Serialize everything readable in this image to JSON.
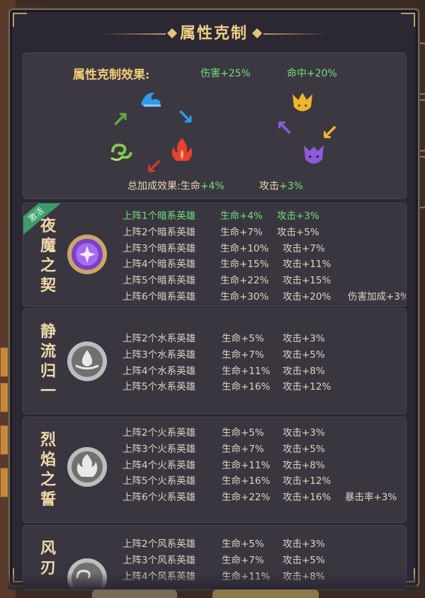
{
  "panel": {
    "title": "属性克制"
  },
  "effect": {
    "label": "属性克制效果:",
    "damage": "伤害+25%",
    "hit": "命中+20%",
    "total_label": "总加成效果:生命",
    "total_hp": "+4%",
    "total_atk_label": "攻击",
    "total_atk": "+3%",
    "elements": [
      "water-icon",
      "fire-icon",
      "wind-icon",
      "light-icon",
      "dark-icon"
    ]
  },
  "sections": [
    {
      "name": [
        "夜",
        "魔",
        "之",
        "契"
      ],
      "ribbon": "激活",
      "icon": "dark-element-icon",
      "rows": [
        {
          "cond": "上阵1个暗系英雄",
          "hp": "生命+4%",
          "atk": "攻击+3%",
          "extra": "",
          "active": true
        },
        {
          "cond": "上阵2个暗系英雄",
          "hp": "生命+7%",
          "atk": "攻击+5%",
          "extra": "",
          "active": false
        },
        {
          "cond": "上阵3个暗系英雄",
          "hp": "生命+10%",
          "atk": "攻击+7%",
          "extra": "",
          "active": false
        },
        {
          "cond": "上阵4个暗系英雄",
          "hp": "生命+15%",
          "atk": "攻击+11%",
          "extra": "",
          "active": false
        },
        {
          "cond": "上阵5个暗系英雄",
          "hp": "生命+22%",
          "atk": "攻击+15%",
          "extra": "",
          "active": false
        },
        {
          "cond": "上阵6个暗系英雄",
          "hp": "生命+30%",
          "atk": "攻击+20%",
          "extra": "伤害加成+3%",
          "active": false
        }
      ]
    },
    {
      "name": [
        "静",
        "流",
        "归",
        "一"
      ],
      "icon": "water-element-icon",
      "rows": [
        {
          "cond": "上阵2个水系英雄",
          "hp": "生命+5%",
          "atk": "攻击+3%",
          "extra": ""
        },
        {
          "cond": "上阵3个水系英雄",
          "hp": "生命+7%",
          "atk": "攻击+5%",
          "extra": ""
        },
        {
          "cond": "上阵4个水系英雄",
          "hp": "生命+11%",
          "atk": "攻击+8%",
          "extra": ""
        },
        {
          "cond": "上阵5个水系英雄",
          "hp": "生命+16%",
          "atk": "攻击+12%",
          "extra": ""
        }
      ]
    },
    {
      "name": [
        "烈",
        "焰",
        "之",
        "誓"
      ],
      "icon": "fire-element-icon",
      "rows": [
        {
          "cond": "上阵2个火系英雄",
          "hp": "生命+5%",
          "atk": "攻击+3%",
          "extra": ""
        },
        {
          "cond": "上阵3个火系英雄",
          "hp": "生命+7%",
          "atk": "攻击+5%",
          "extra": ""
        },
        {
          "cond": "上阵4个火系英雄",
          "hp": "生命+11%",
          "atk": "攻击+8%",
          "extra": ""
        },
        {
          "cond": "上阵5个火系英雄",
          "hp": "生命+16%",
          "atk": "攻击+12%",
          "extra": ""
        },
        {
          "cond": "上阵6个火系英雄",
          "hp": "生命+22%",
          "atk": "攻击+16%",
          "extra": "暴击率+3%"
        }
      ]
    },
    {
      "name": [
        "风",
        "刃"
      ],
      "icon": "wind-element-icon",
      "rows": [
        {
          "cond": "上阵2个风系英雄",
          "hp": "生命+5%",
          "atk": "攻击+3%",
          "extra": ""
        },
        {
          "cond": "上阵3个风系英雄",
          "hp": "生命+7%",
          "atk": "攻击+5%",
          "extra": ""
        },
        {
          "cond": "上阵4个风系英雄",
          "hp": "生命+11%",
          "atk": "攻击+8%",
          "extra": ""
        }
      ]
    }
  ],
  "colors": {
    "active": "#6fe07a",
    "title": "#f0cf85",
    "text": "#ddd3c3"
  }
}
